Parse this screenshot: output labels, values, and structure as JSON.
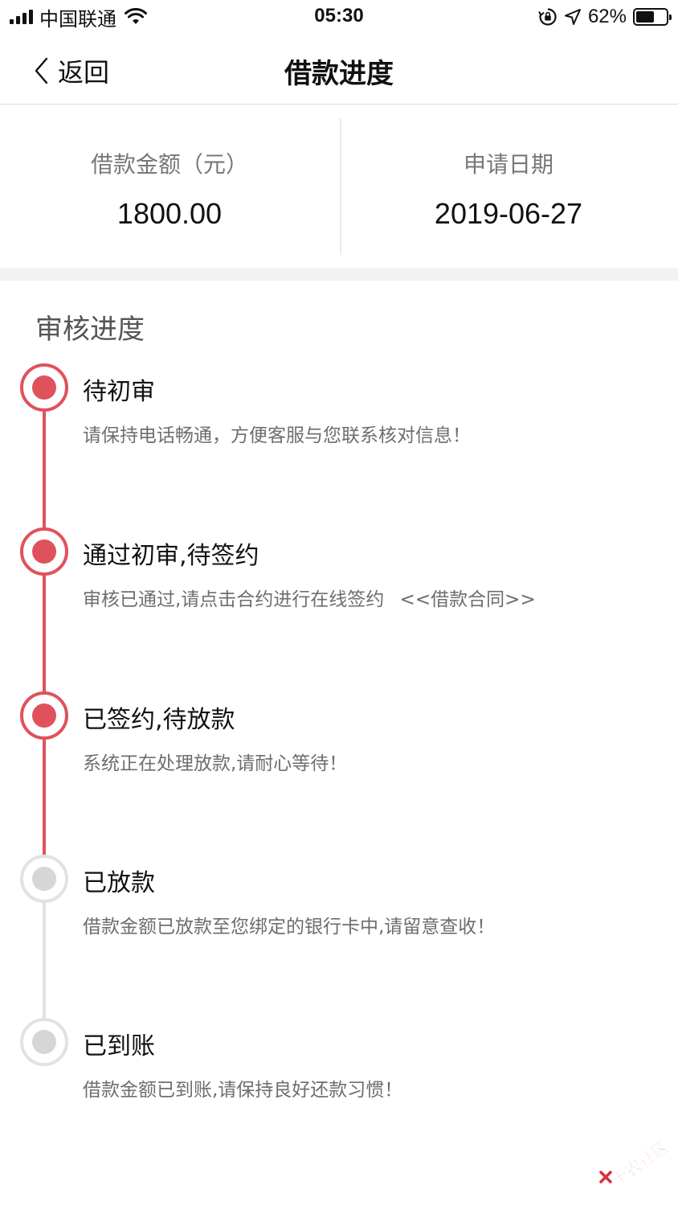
{
  "status_bar": {
    "carrier": "中国联通",
    "time": "05:30",
    "battery_percent": "62%",
    "battery_level": 0.62
  },
  "nav": {
    "back_label": "返回",
    "title": "借款进度"
  },
  "summary": {
    "amount_label": "借款金额（元）",
    "amount_value": "1800.00",
    "date_label": "申请日期",
    "date_value": "2019-06-27"
  },
  "progress": {
    "section_title": "审核进度",
    "steps": [
      {
        "title": "待初审",
        "desc": "请保持电话畅通，方便客服与您联系核对信息！",
        "status": "active"
      },
      {
        "title": "通过初审,待签约",
        "desc": "审核已通过,请点击合约进行在线签约",
        "link": "<<借款合同>>",
        "status": "active"
      },
      {
        "title": "已签约,待放款",
        "desc": "系统正在处理放款,请耐心等待！",
        "status": "active"
      },
      {
        "title": "已放款",
        "desc": "借款金额已放款至您绑定的银行卡中,请留意查收！",
        "status": "inactive"
      },
      {
        "title": "已到账",
        "desc": "借款金额已到账,请保持良好还款习惯！",
        "status": "inactive"
      }
    ]
  },
  "watermark": {
    "text": "卡农社区"
  },
  "colors": {
    "accent": "#e0525b",
    "inactive": "#d6d6d6",
    "muted_text": "#6e6e6e"
  }
}
